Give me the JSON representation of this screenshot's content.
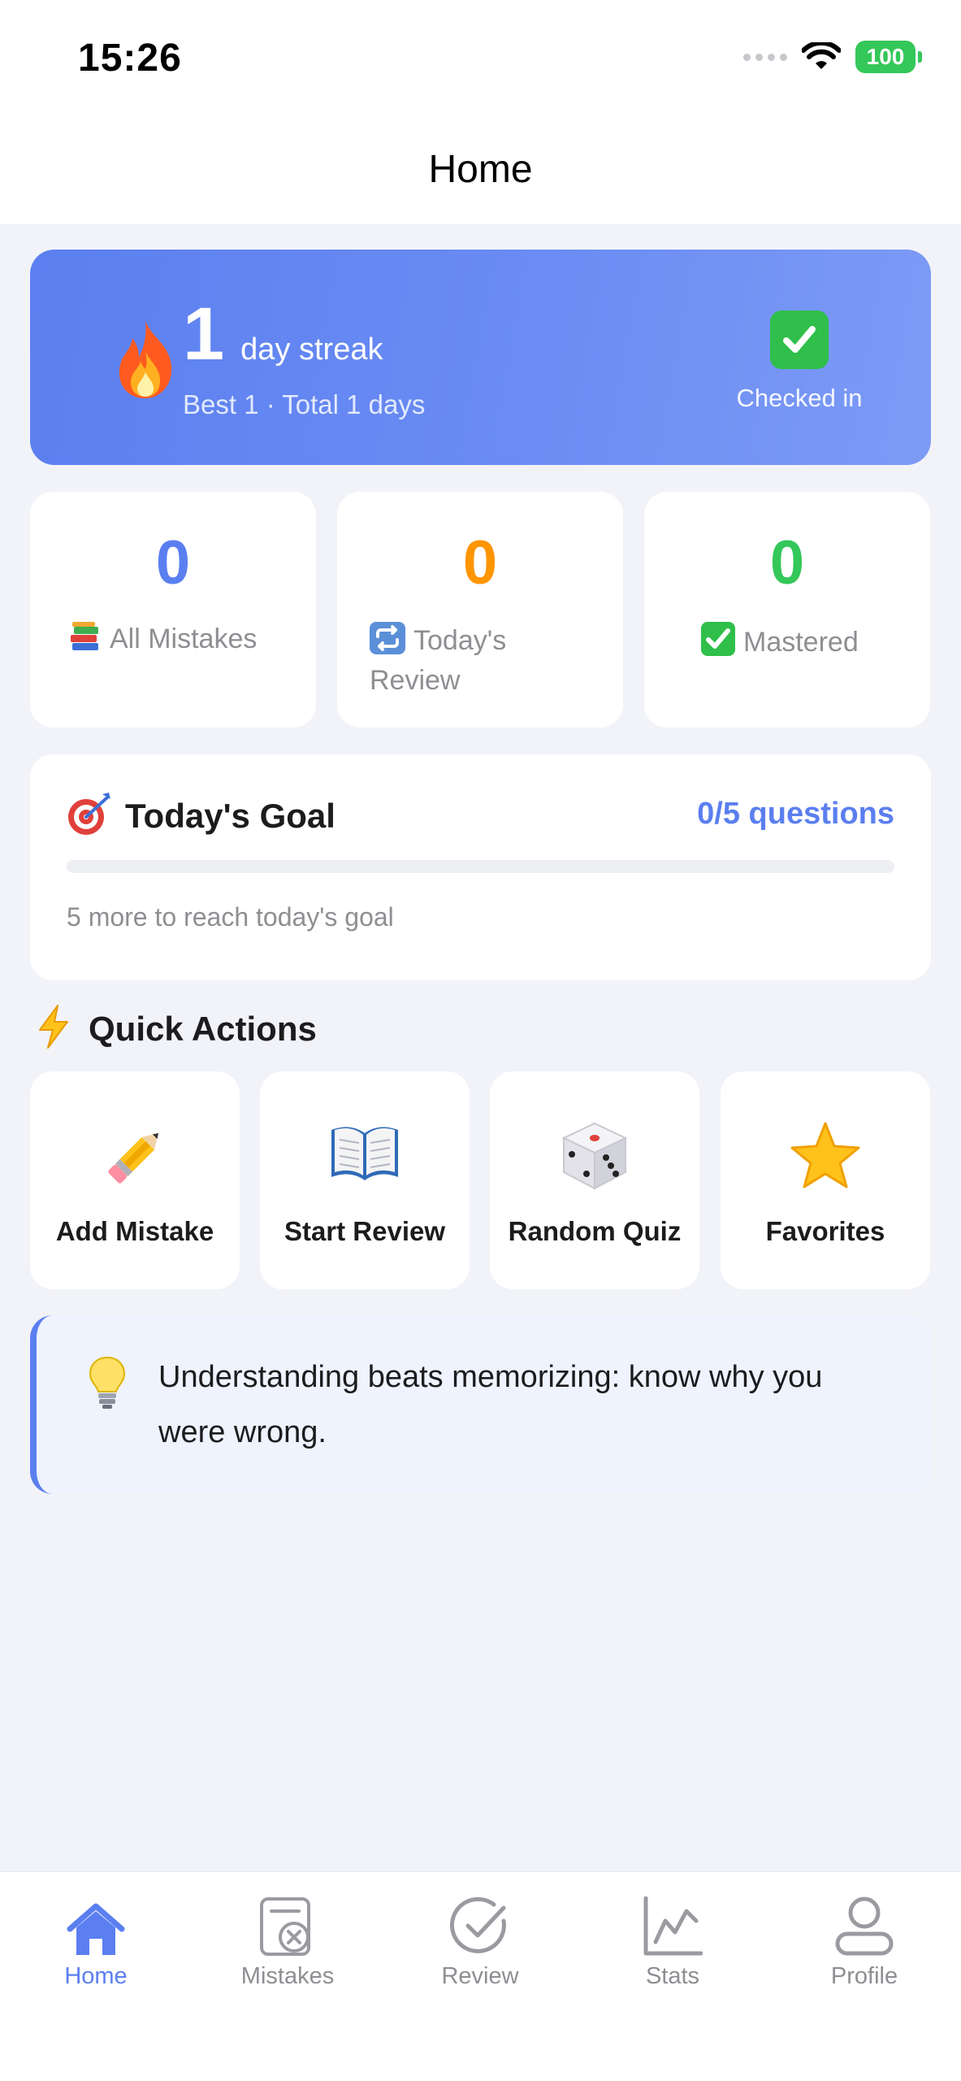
{
  "status_bar": {
    "time": "15:26",
    "battery": "100"
  },
  "nav": {
    "title": "Home"
  },
  "streak": {
    "count": "1",
    "label": "day streak",
    "sub": "Best 1 · Total 1 days",
    "checkin_label": "Checked in"
  },
  "stats": [
    {
      "value": "0",
      "label": "All Mistakes",
      "color": "#5b7ff0",
      "icon": "books-icon"
    },
    {
      "value": "0",
      "label": "Today's Review",
      "color": "#ff9500",
      "icon": "repeat-icon"
    },
    {
      "value": "0",
      "label": "Mastered",
      "color": "#34c759",
      "icon": "check-icon"
    }
  ],
  "goal": {
    "title": "Today's Goal",
    "count": "0/5 questions",
    "progress": 0,
    "hint": "5 more to reach today's goal"
  },
  "quick_actions": {
    "title": "Quick Actions",
    "items": [
      {
        "label": "Add Mistake",
        "icon": "pencil-icon"
      },
      {
        "label": "Start Review",
        "icon": "book-icon"
      },
      {
        "label": "Random Quiz",
        "icon": "dice-icon"
      },
      {
        "label": "Favorites",
        "icon": "star-icon"
      }
    ]
  },
  "tip": {
    "text": "Understanding beats memorizing: know why you were wrong."
  },
  "tabs": [
    {
      "label": "Home",
      "icon": "home-icon",
      "active": true
    },
    {
      "label": "Mistakes",
      "icon": "mistakes-icon",
      "active": false
    },
    {
      "label": "Review",
      "icon": "review-icon",
      "active": false
    },
    {
      "label": "Stats",
      "icon": "stats-icon",
      "active": false
    },
    {
      "label": "Profile",
      "icon": "profile-icon",
      "active": false
    }
  ],
  "colors": {
    "accent": "#5b7ff0",
    "orange": "#ff9500",
    "green": "#34c759"
  }
}
